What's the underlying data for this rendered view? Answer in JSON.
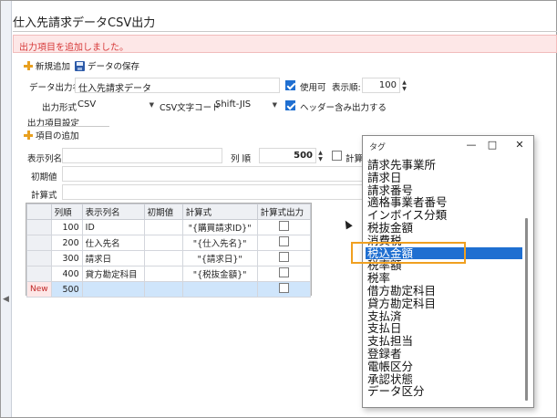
{
  "window": {
    "title": "仕入先請求データCSV出力"
  },
  "banner": {
    "message": "出力項目を追加しました。"
  },
  "toolbar": {
    "new_label": "新規追加",
    "save_label": "データの保存"
  },
  "form": {
    "name_label": "データ出力名",
    "name_value": "仕入先請求データ",
    "usable_label": "使用可",
    "order_label": "表示順:",
    "order_value": "100",
    "format_label": "出力形式",
    "format_value": "CSV",
    "encoding_label": "CSV文字コード",
    "encoding_value": "Shift-JIS",
    "header_label": "ヘッダー含み出力する"
  },
  "section": {
    "title": "出力項目設定",
    "add_item_label": "項目の追加",
    "display_name_label": "表示列名",
    "column_order_label": "列 順",
    "column_order_value": "500",
    "calc_label": "計算",
    "initial_label": "初期値",
    "formula_label": "計算式"
  },
  "grid": {
    "headers": [
      "列順",
      "表示列名",
      "初期値",
      "計算式",
      "計算式出力"
    ],
    "rows": [
      {
        "order": "100",
        "name": "ID",
        "initial": "",
        "formula": "\"{購買請求ID}\""
      },
      {
        "order": "200",
        "name": "仕入先名",
        "initial": "",
        "formula": "\"{仕入先名}\""
      },
      {
        "order": "300",
        "name": "請求日",
        "initial": "",
        "formula": "\"{請求日}\""
      },
      {
        "order": "400",
        "name": "貸方勘定科目",
        "initial": "",
        "formula": "\"{税抜金額}\""
      }
    ],
    "new_row": {
      "marker": "New",
      "order": "500"
    }
  },
  "popup": {
    "title": "タグ",
    "items": [
      "請求先事業所",
      "請求日",
      "請求番号",
      "適格事業者番号",
      "インボイス分類",
      "税抜金額",
      "消費税",
      "税込金額",
      "税率額",
      "税率",
      "借方勘定科目",
      "貸方勘定科目",
      "支払済",
      "支払日",
      "支払担当",
      "登録者",
      "電帳区分",
      "承認状態",
      "データ区分"
    ],
    "selected_index": 7
  },
  "colors": {
    "accent": "#1f6fd1",
    "banner_bg": "#fde7e7",
    "banner_text": "#d73a3a",
    "highlight": "#f0a020"
  },
  "icons": [
    "plus-icon",
    "save-icon",
    "minimize-icon",
    "maximize-icon",
    "close-icon",
    "mouse-cursor-icon"
  ]
}
